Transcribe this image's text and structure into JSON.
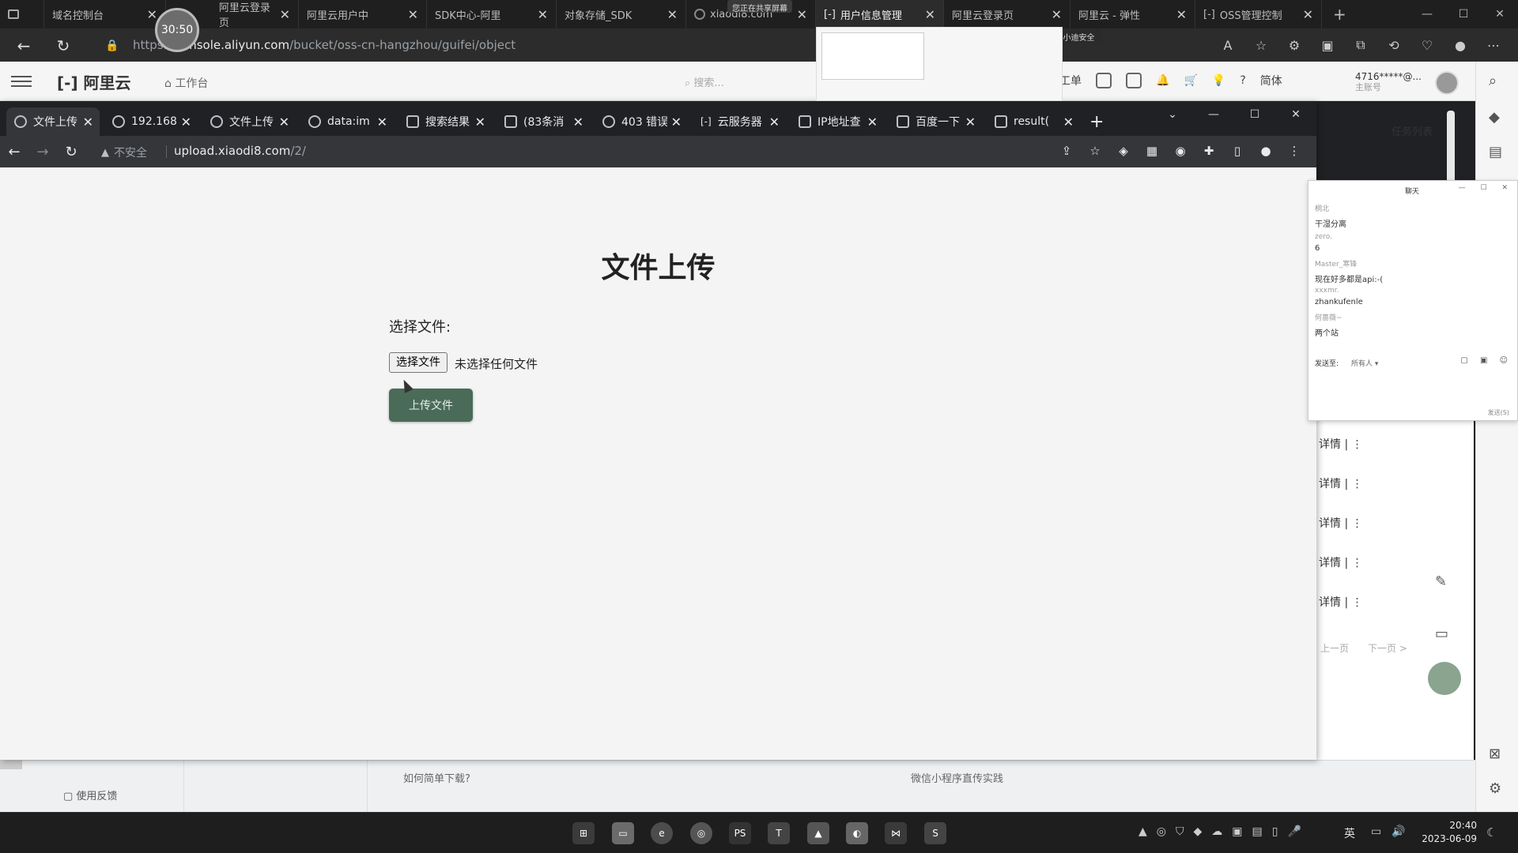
{
  "outer_browser": {
    "tabs": [
      {
        "label": "域名控制台"
      },
      {
        "label": "阿里云登录页"
      },
      {
        "label": "阿里云用户中"
      },
      {
        "label": "SDK中心-阿里"
      },
      {
        "label": "对象存储_SDK"
      },
      {
        "label": "xiaodi8.com"
      },
      {
        "label": "用户信息管理"
      },
      {
        "label": "阿里云登录页"
      },
      {
        "label": "阿里云 - 弹性"
      },
      {
        "label": "OSS管理控制"
      }
    ],
    "url_prefix": "https://",
    "url_domain": "console.aliyun.com",
    "url_path": "/bucket/oss-cn-hangzhou/guifei/object",
    "timer_badge": "30:50",
    "share_notice": "您正在共享屏幕",
    "speaking_notice": "正在讲话: 小迪安全"
  },
  "aliyun_console": {
    "logo": "[-] 阿里云",
    "workbench": "工作台",
    "search_placeholder": "搜索...",
    "header_items": [
      "工单",
      "简体"
    ],
    "account_id": "4716*****@...",
    "account_sub": "主账号",
    "task_list": "任务列表",
    "detail_rows": [
      "详情 | ⋮",
      "详情 | ⋮",
      "详情 | ⋮",
      "详情 | ⋮",
      "详情 | ⋮"
    ],
    "pager_prev": "上一页",
    "pager_next": "下一页 >",
    "feedback": "使用反馈",
    "footer_q1": "如何简单下载?",
    "footer_q2": "微信小程序直传实践"
  },
  "inner_browser": {
    "tabs": [
      {
        "label": "文件上传"
      },
      {
        "label": "192.168"
      },
      {
        "label": "文件上传"
      },
      {
        "label": "data:im"
      },
      {
        "label": "搜索结果"
      },
      {
        "label": "(83条消"
      },
      {
        "label": "403 错误"
      },
      {
        "label": "云服务器"
      },
      {
        "label": "IP地址查"
      },
      {
        "label": "百度一下"
      },
      {
        "label": "result("
      }
    ],
    "insecure_label": "不安全",
    "url_domain": "upload.xiaodi8.com",
    "url_path": "/2/"
  },
  "upload_page": {
    "title": "文件上传",
    "choose_label": "选择文件:",
    "file_button": "选择文件",
    "no_file_text": "未选择任何文件",
    "upload_button": "上传文件"
  },
  "chat": {
    "title": "聊天",
    "messages": [
      {
        "user": "桐北",
        "text": "干湿分离"
      },
      {
        "user": "zero.",
        "text": "6"
      },
      {
        "user": "Master_寒锋",
        "text": "现在好多都是api:-("
      },
      {
        "user": "xxxmr.",
        "text": "zhankufenle"
      },
      {
        "user": "何蔷薇~",
        "text": "两个站"
      }
    ],
    "send_to": "发送至:",
    "recipient": "所有人 ▾",
    "footer": "发送(S)"
  },
  "taskbar": {
    "apps": [
      "windows-start",
      "file-explorer",
      "edge",
      "chrome",
      "phpstorm",
      "app-tshirt",
      "app-photo",
      "app-chat",
      "vscode",
      "sublime"
    ],
    "lang": "英",
    "time": "20:40",
    "date": "2023-06-09"
  }
}
